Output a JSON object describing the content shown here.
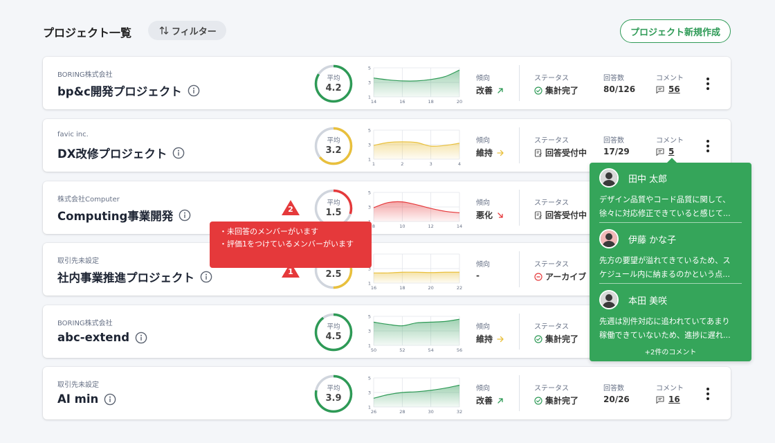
{
  "header": {
    "title": "プロジェクト一覧",
    "filter_label": "フィルター",
    "new_project_label": "プロジェクト新規作成"
  },
  "labels": {
    "avg": "平均",
    "trend": "傾向",
    "status": "ステータス",
    "answers": "回答数",
    "comments": "コメント"
  },
  "colors": {
    "good": "#2e9a56",
    "neutral": "#e9c03c",
    "bad": "#e5393b",
    "gray": "#d0d5dd"
  },
  "projects": [
    {
      "company": "BORING株式会社",
      "name": "bp&c開発プロジェクト",
      "avg": "4.2",
      "avg_value": 4.2,
      "level": "good",
      "trend": "改善",
      "trend_icon": "arrow-up-right-icon",
      "status": "集計完了",
      "status_icon": "check-circle-icon",
      "answers": "80/126",
      "comments": "56",
      "chart_data": {
        "type": "area",
        "x_ticks": [
          "14",
          "16",
          "18",
          "20"
        ],
        "y_ticks": [
          "1",
          "3",
          "5"
        ],
        "ylim": [
          1,
          5
        ],
        "x": [
          14,
          15,
          16,
          17,
          18,
          19,
          20
        ],
        "values": [
          3.6,
          3.35,
          3.2,
          3.2,
          3.4,
          3.8,
          4.7
        ]
      }
    },
    {
      "company": "favic inc.",
      "name": "DX改修プロジェクト",
      "avg": "3.2",
      "avg_value": 3.2,
      "level": "neutral",
      "trend": "維持",
      "trend_icon": "arrow-right-icon",
      "status": "回答受付中",
      "status_icon": "form-icon",
      "answers": "17/29",
      "comments": "5",
      "chart_data": {
        "type": "area",
        "x_ticks": [
          "1",
          "2",
          "3",
          "4"
        ],
        "y_ticks": [
          "1",
          "3",
          "5"
        ],
        "ylim": [
          1,
          5
        ],
        "x": [
          1,
          1.5,
          2,
          2.5,
          3,
          3.5,
          4
        ],
        "values": [
          2.9,
          3.3,
          3.4,
          3.3,
          2.8,
          2.9,
          3.2
        ]
      }
    },
    {
      "company": "株式会社Computer",
      "name": "Computing事業開発",
      "avg": "1.5",
      "avg_value": 1.5,
      "level": "bad",
      "trend": "悪化",
      "trend_icon": "arrow-down-right-icon",
      "status": "回答受付中",
      "status_icon": "form-icon",
      "answers": "",
      "comments": "",
      "chart_data": {
        "type": "area",
        "x_ticks": [
          "8",
          "10",
          "12",
          "14"
        ],
        "y_ticks": [
          "1",
          "3",
          "5"
        ],
        "ylim": [
          1,
          5
        ],
        "x": [
          8,
          9,
          10,
          11,
          12,
          13,
          14
        ],
        "values": [
          2.9,
          3.6,
          3.7,
          3.3,
          2.8,
          2.4,
          2.2
        ]
      }
    },
    {
      "company": "取引先未設定",
      "name": "社内事業推進プロジェクト",
      "avg": "2.5",
      "avg_value": 2.5,
      "level": "neutral",
      "trend": "-",
      "trend_icon": "",
      "status": "アーカイブ",
      "status_icon": "minus-circle-icon",
      "answers": "",
      "comments": "",
      "chart_data": {
        "type": "area",
        "x_ticks": [
          "16",
          "18",
          "20",
          "22"
        ],
        "y_ticks": [
          "1",
          "3",
          "5"
        ],
        "ylim": [
          1,
          5
        ],
        "x": [
          16,
          17,
          18,
          19,
          20,
          21,
          22
        ],
        "values": [
          2.4,
          2.4,
          2.5,
          2.5,
          2.45,
          2.5,
          2.5
        ]
      }
    },
    {
      "company": "BORING株式会社",
      "name": "abc-extend",
      "avg": "4.5",
      "avg_value": 4.5,
      "level": "good",
      "trend": "維持",
      "trend_icon": "arrow-right-icon",
      "status": "集計完了",
      "status_icon": "check-circle-icon",
      "answers": "",
      "comments": "",
      "chart_data": {
        "type": "area",
        "x_ticks": [
          "50",
          "52",
          "54",
          "56"
        ],
        "y_ticks": [
          "1",
          "3",
          "5"
        ],
        "ylim": [
          1,
          5
        ],
        "x": [
          50,
          51,
          52,
          53,
          54,
          55,
          56
        ],
        "values": [
          4.2,
          3.9,
          3.7,
          4.1,
          4.2,
          4.3,
          4.6
        ]
      }
    },
    {
      "company": "取引先未設定",
      "name": "AI min",
      "avg": "3.9",
      "avg_value": 3.9,
      "level": "good",
      "trend": "改善",
      "trend_icon": "arrow-up-right-icon",
      "status": "集計完了",
      "status_icon": "check-circle-icon",
      "answers": "20/26",
      "comments": "16",
      "chart_data": {
        "type": "area",
        "x_ticks": [
          "26",
          "28",
          "30",
          "32"
        ],
        "y_ticks": [
          "1",
          "3",
          "5"
        ],
        "ylim": [
          1,
          5
        ],
        "x": [
          26,
          27,
          28,
          29,
          30,
          31,
          32
        ],
        "values": [
          2.2,
          2.7,
          3.0,
          3.1,
          3.3,
          3.6,
          4.0
        ]
      }
    }
  ],
  "warning": {
    "lines": [
      "・未回答のメンバーがいます",
      "・評価1をつけているメンバーがいます"
    ],
    "marker_top": "2",
    "marker_bottom": "1"
  },
  "comments_popover": {
    "items": [
      {
        "author": "田中 太郎",
        "avatar_color": "#d9d9d9",
        "text": [
          "デザイン品質やコード品質に関して、",
          "徐々に対応修正できていると感じて..."
        ]
      },
      {
        "author": "伊藤 かな子",
        "avatar_color": "#f2b8b8",
        "text": [
          "先方の要望が溢れてきているため、ス",
          "ケジュール内に納まるのかという点..."
        ]
      },
      {
        "author": "本田 美咲",
        "avatar_color": "#d9d9d9",
        "text": [
          "先週は別件対応に追われていてあまり",
          "稼働できていないため、進捗に遅れ..."
        ]
      }
    ],
    "more": "+2件のコメント"
  }
}
